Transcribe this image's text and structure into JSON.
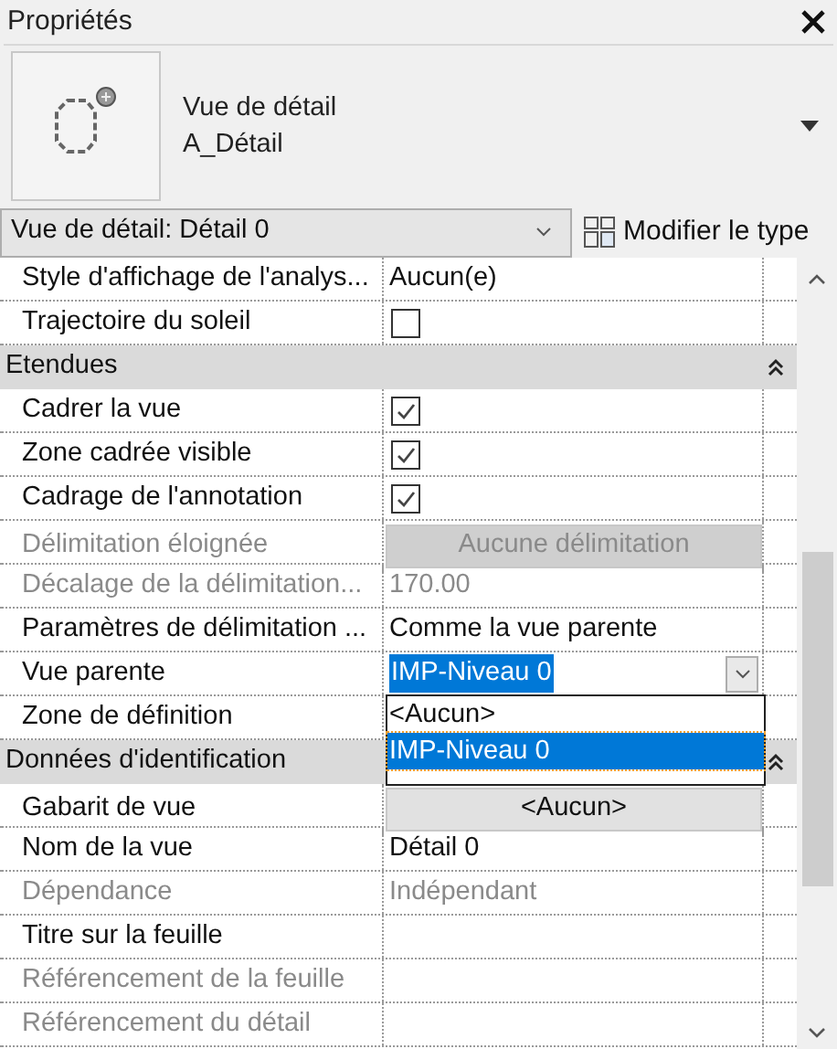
{
  "panel": {
    "title": "Propriétés"
  },
  "type_selector": {
    "family": "Vue de détail",
    "type": "A_Détail"
  },
  "instance_selector": {
    "value": "Vue de détail: Détail 0"
  },
  "edit_type_button": {
    "label": "Modifier le type"
  },
  "rows": [
    {
      "kind": "text",
      "label": "Style d'affichage de l'analys...",
      "value": "Aucun(e)",
      "disabled": false
    },
    {
      "kind": "checkbox",
      "label": "Trajectoire du soleil",
      "checked": false,
      "disabled": false
    },
    {
      "kind": "group",
      "label": "Etendues",
      "expanded": true
    },
    {
      "kind": "checkbox",
      "label": "Cadrer la vue",
      "checked": true,
      "disabled": false
    },
    {
      "kind": "checkbox",
      "label": "Zone cadrée visible",
      "checked": true,
      "disabled": false
    },
    {
      "kind": "checkbox",
      "label": "Cadrage de l'annotation",
      "checked": true,
      "disabled": false
    },
    {
      "kind": "button",
      "label": "Délimitation éloignée",
      "value": "Aucune délimitation",
      "disabled": true
    },
    {
      "kind": "text",
      "label": "Décalage de la délimitation...",
      "value": "170.00",
      "disabled": true
    },
    {
      "kind": "text",
      "label": "Paramètres de délimitation ...",
      "value": "Comme la vue parente",
      "disabled": false
    },
    {
      "kind": "dropdown",
      "label": "Vue parente",
      "value": "IMP-Niveau 0",
      "expanded": true,
      "disabled": false,
      "options": [
        {
          "label": "<Aucun>",
          "selected": false
        },
        {
          "label": "IMP-Niveau 0",
          "selected": true
        }
      ]
    },
    {
      "kind": "text",
      "label": "Zone de définition",
      "disabled": false
    },
    {
      "kind": "group",
      "label": "Données d'identification",
      "expanded": true
    },
    {
      "kind": "button",
      "label": "Gabarit de vue",
      "value": "<Aucun>",
      "disabled": false
    },
    {
      "kind": "text",
      "label": "Nom de la vue",
      "value": "Détail 0",
      "disabled": false
    },
    {
      "kind": "text",
      "label": "Dépendance",
      "value": "Indépendant",
      "disabled": true
    },
    {
      "kind": "text",
      "label": "Titre sur la feuille",
      "disabled": false
    },
    {
      "kind": "text",
      "label": "Référencement de la feuille",
      "disabled": true
    },
    {
      "kind": "text",
      "label": "Référencement du détail",
      "disabled": true
    }
  ]
}
